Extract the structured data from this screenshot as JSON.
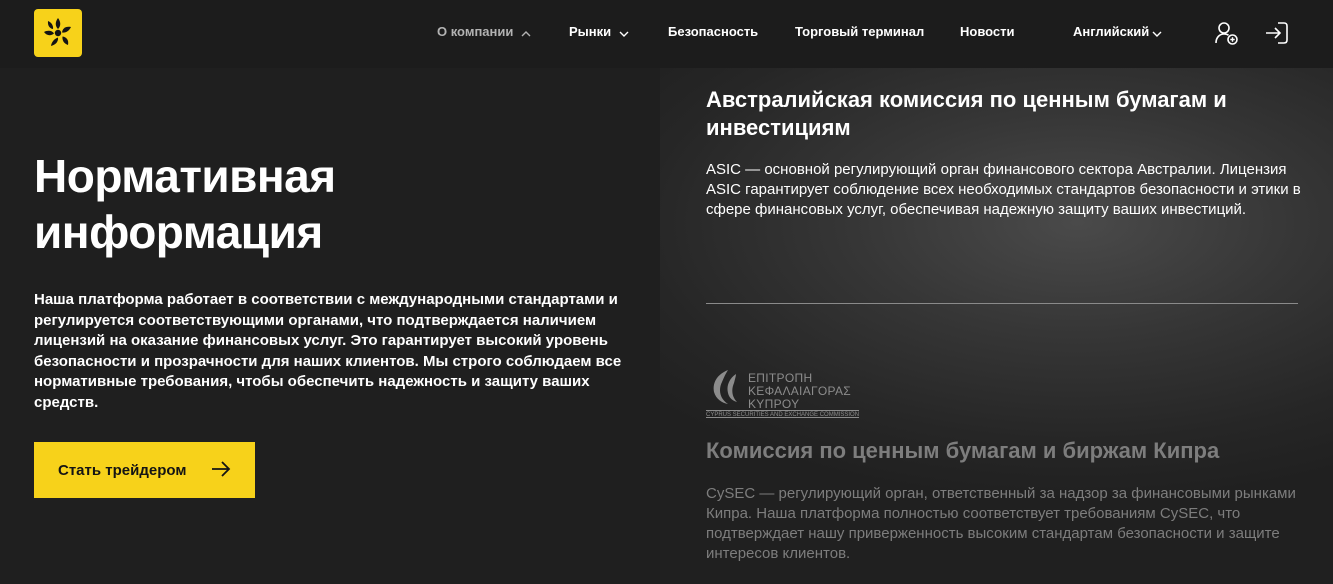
{
  "header": {
    "nav": [
      {
        "label": "О компании",
        "has_dropdown": true,
        "expanded": true
      },
      {
        "label": "Рынки",
        "has_dropdown": true
      },
      {
        "label": "Безопасность",
        "has_dropdown": false
      },
      {
        "label": "Торговый терминал",
        "has_dropdown": false
      },
      {
        "label": "Новости",
        "has_dropdown": false
      }
    ],
    "language": "Английский",
    "icons": [
      "add-user-icon",
      "login-icon"
    ]
  },
  "hero": {
    "title_line1": "Нормативная",
    "title_line2": "информация",
    "description": "Наша платформа работает в соответствии с международными стандартами и регулируется соответствующими органами, что подтверждается наличием лицензий на оказание финансовых услуг. Это гарантирует высокий уровень безопасности и прозрачности для наших клиентов. Мы строго соблюдаем все нормативные требования, чтобы обеспечить надежность и защиту ваших средств.",
    "cta_label": "Стать трейдером"
  },
  "regulators": [
    {
      "title": "Австралийская комиссия по ценным бумагам и инвестициям",
      "description": "ASIC — основной регулирующий орган финансового сектора Австралии. Лицензия ASIC гарантирует соблюдение всех необходимых стандартов безопасности и этики в сфере финансовых услуг, обеспечивая надежную защиту ваших инвестиций."
    },
    {
      "logo": {
        "line1": "ΕΠΙΤΡΟΠΗ",
        "line2": "ΚΕΦΑΛΑΙΑΓΟΡΑΣ",
        "line3": "ΚΥΠΡΟΥ",
        "english": "CYPRUS SECURITIES AND EXCHANGE COMMISSION"
      },
      "title": "Комиссия по ценным бумагам и биржам Кипра",
      "description": "CySEC — регулирующий орган, ответственный за надзор за финансовыми рынками Кипра. Наша платформа полностью соответствует требованиям CySEC, что подтверждает нашу приверженность высоким стандартам безопасности и защите интересов клиентов."
    }
  ],
  "colors": {
    "accent": "#f7d21a",
    "background": "#1f1f1f",
    "muted_text": "#7d7d7d"
  }
}
